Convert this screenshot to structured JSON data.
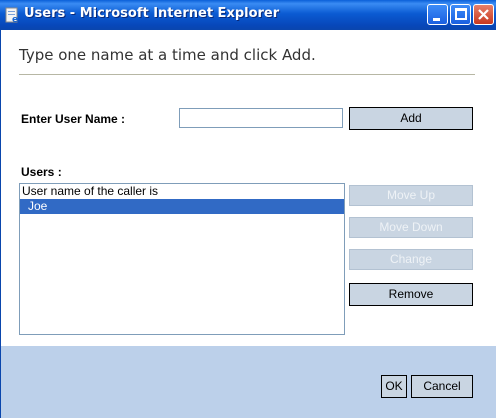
{
  "window": {
    "title": "Users - Microsoft Internet Explorer"
  },
  "instruction": "Type one name at a time and click Add.",
  "username": {
    "label": "Enter User Name :",
    "value": "",
    "placeholder": ""
  },
  "buttons": {
    "add": "Add",
    "move_up": "Move Up",
    "move_down": "Move Down",
    "change": "Change",
    "remove": "Remove",
    "ok": "OK",
    "cancel": "Cancel"
  },
  "users": {
    "label": "Users :",
    "items": [
      {
        "label": "User name of the caller is",
        "selected": false
      },
      {
        "label": "Joe",
        "selected": true
      }
    ]
  },
  "icons": [
    "ie-page-icon",
    "minimize-icon",
    "maximize-icon",
    "close-icon"
  ]
}
